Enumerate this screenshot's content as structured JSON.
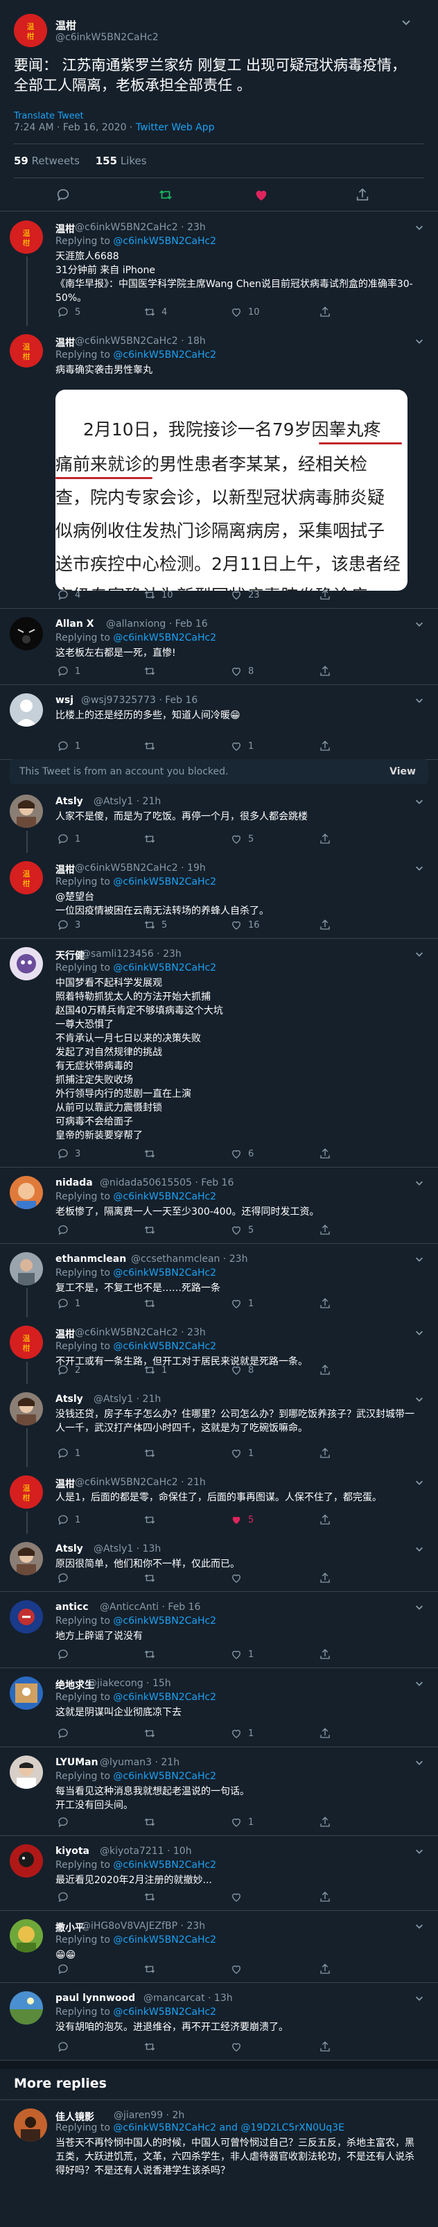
{
  "main_tweet": {
    "name": "温柑",
    "handle": "@c6inkW5BN2CaHc2",
    "text": "要闻：  江苏南通紫罗兰家纺 刚复工 出现可疑冠状病毒疫情，全部工人隔离，老板承担全部责任 。",
    "translate": "Translate Tweet",
    "timestamp": "7:24 AM · Feb 16, 2020 · ",
    "source": "Twitter Web App",
    "retweets_count": "59",
    "retweets_label": "Retweets",
    "likes_count": "155",
    "likes_label": "Likes"
  },
  "image_text": {
    "line1": "2月10日，我院接诊一名79岁因睾丸疼",
    "line2": "痛前来就诊的男性患者李某某，经相关检",
    "line3": "查，院内专家会诊，以新型冠状病毒肺炎疑",
    "line4": "似病例收住发热门诊隔离病房，采集咽拭子",
    "line5": "送市疾控中心检测。2月11日上午，该患者经",
    "line6": "市级专家确认为新型冠状病毒肺炎确诊病"
  },
  "replies": [
    {
      "name": "温柑",
      "handle": "@c6inkW5BN2CaHc2 · 23h",
      "replying": "Replying to ",
      "to": "@c6inkW5BN2CaHc2",
      "text": "天涯旅人6688\n31分钟前 来自 iPhone\n《南华早报》：中国医学科学院主席Wang Chen说目前冠状病毒试剂盒的准确率30-50%。",
      "reply": "5",
      "retweet": "4",
      "like": "10"
    },
    {
      "name": "温柑",
      "handle": "@c6inkW5BN2CaHc2 · 18h",
      "replying": "Replying to ",
      "to": "@c6inkW5BN2CaHc2",
      "text": "病毒确实袭击男性睾丸",
      "reply": "4",
      "retweet": "10",
      "like": "23"
    },
    {
      "name": "Allan X",
      "handle": "@allanxiong · Feb 16",
      "replying": "Replying to ",
      "to": "@c6inkW5BN2CaHc2",
      "text": "这老板左右都是一死，直惨!",
      "reply": "1",
      "retweet": "",
      "like": "8"
    },
    {
      "name": "wsj",
      "handle": "@wsj97325773 · Feb 16",
      "replying": "",
      "to": "",
      "text": "比楼上的还是经历的多些，知道人间冷暖😁",
      "reply": "1",
      "retweet": "",
      "like": "1"
    },
    {
      "name": "Atsly",
      "handle": "@Atsly1 · 21h",
      "replying": "",
      "to": "",
      "text": "人家不是傻，而是为了吃饭。再停一个月，很多人都会跳楼",
      "reply": "1",
      "retweet": "",
      "like": "5"
    },
    {
      "name": "温柑",
      "handle": "@c6inkW5BN2CaHc2 · 19h",
      "replying": "Replying to ",
      "to": "@c6inkW5BN2CaHc2",
      "text": "@楚望台\n一位因疫情被困在云南无法转场的养蜂人自杀了。",
      "reply": "3",
      "retweet": "5",
      "like": "16"
    },
    {
      "name": "天行健",
      "handle": "@samli123456 · 23h",
      "replying": "Replying to ",
      "to": "@c6inkW5BN2CaHc2",
      "text": "中国梦看不起科学发展观\n照着特勒抓犹太人的方法开始大抓捕\n赵国40万精兵肯定不够填病毒这个大坑\n一尊大恐惧了\n不肯承认一月七日以来的决策失败\n发起了对自然规律的挑战\n有无症状带病毒的\n抓捕注定失败收场\n外行领导内行的悲剧一直在上演\n从前可以靠武力震慑封锁\n可病毒不会给面子\n皇帝的新装要穿帮了",
      "reply": "3",
      "retweet": "",
      "like": "6"
    },
    {
      "name": "nidada",
      "handle": "@nidada50615505 · Feb 16",
      "replying": "Replying to ",
      "to": "@c6inkW5BN2CaHc2",
      "text": "老板惨了，隔离费一人一天至少300-400。还得同时发工资。",
      "reply": "",
      "retweet": "",
      "like": "5"
    },
    {
      "name": "ethanmclean",
      "handle": "@ccsethanmclean · 23h",
      "replying": "Replying to ",
      "to": "@c6inkW5BN2CaHc2",
      "text": "复工不是，不复工也不是……死路一条",
      "reply": "1",
      "retweet": "",
      "like": "1"
    },
    {
      "name": "温柑",
      "handle": "@c6inkW5BN2CaHc2 · 23h",
      "replying": "Replying to ",
      "to": "@c6inkW5BN2CaHc2",
      "text": "不开工或有一条生路，但开工对于居民来说就是死路一条。",
      "reply": "2",
      "retweet": "1",
      "like": "8"
    },
    {
      "name": "Atsly",
      "handle": "@Atsly1 · 21h",
      "replying": "",
      "to": "",
      "text": "没钱还贷，房子车子怎么办？住哪里？公司怎么办？到哪吃饭养孩子？武汉封城带一人一千，武汉打产体四小时四千，这就是为了吃碗饭嘛命。",
      "reply": "1",
      "retweet": "",
      "like": "1"
    },
    {
      "name": "温柑",
      "handle": "@c6inkW5BN2CaHc2 · 21h",
      "replying": "",
      "to": "",
      "text": "人是1，后面的都是零，命保住了，后面的事再图谋。人保不住了，都完蛋。",
      "reply": "1",
      "retweet": "",
      "like": "5"
    },
    {
      "name": "Atsly",
      "handle": "@Atsly1 · 13h",
      "replying": "",
      "to": "",
      "text": "原因很简单，他们和你不一样，仅此而已。",
      "reply": "",
      "retweet": "",
      "like": ""
    },
    {
      "name": "anticc",
      "handle": "@AnticcAnti · Feb 16",
      "replying": "Replying to ",
      "to": "@c6inkW5BN2CaHc2",
      "text": "地方上辟谣了说没有",
      "reply": "",
      "retweet": "",
      "like": "1"
    },
    {
      "name": "绝地求生",
      "handle": "@jiakecong · 15h",
      "replying": "Replying to ",
      "to": "@c6inkW5BN2CaHc2",
      "text": "这就是阴谋叫企业彻底凉下去",
      "reply": "",
      "retweet": "",
      "like": "1"
    },
    {
      "name": "LYUMan",
      "handle": "@lyuman3 · 21h",
      "replying": "Replying to ",
      "to": "@c6inkW5BN2CaHc2",
      "text": "每当看见这种消息我就想起老温说的一句话。\n开工没有回头间。",
      "reply": "",
      "retweet": "",
      "like": "1"
    },
    {
      "name": "kiyota",
      "handle": "@kiyota7211 · 10h",
      "replying": "Replying to ",
      "to": "@c6inkW5BN2CaHc2",
      "text": "最近看见2020年2月注册的就撤妙...",
      "reply": "",
      "retweet": "",
      "like": ""
    },
    {
      "name": "撒小平",
      "handle": "@iHG8oV8VAJEZfBP · 23h",
      "replying": "Replying to ",
      "to": "@c6inkW5BN2CaHc2",
      "text": "😁😁",
      "reply": "",
      "retweet": "",
      "like": ""
    },
    {
      "name": "paul lynnwood",
      "handle": "@mancarcat · 13h",
      "replying": "Replying to ",
      "to": "@c6inkW5BN2CaHc2",
      "text": "没有胡咱的泡灰。进退维谷，再不开工经济要崩溃了。",
      "reply": "",
      "retweet": "",
      "like": ""
    }
  ],
  "blocked_notice": {
    "text": "This Tweet is from an account you blocked.",
    "action": "View"
  },
  "more_replies": {
    "heading": "More replies",
    "name": "佳人镜影",
    "handle": "@jiaren99 · 2h",
    "replying": "Replying to ",
    "to": "@c6inkW5BN2CaHc2 and @19D2LC5rXN0Uq3E",
    "text": "当苍天不再怜悯中国人的时候，中国人可曾怜悯过自己？三反五反，杀地主富农，黑五类，大跃进饥荒，文革，六四杀学生，非人虐待器官收割法轮功，不是还有人说杀得好吗？不是还有人说香港学生该杀吗？"
  },
  "colors": {
    "background": "#15202b",
    "divider": "#38444d",
    "link": "#1da1f2",
    "secondary_text": "#8899a6",
    "retweet_green": "#17bf63",
    "like_pink": "#e0245e"
  }
}
